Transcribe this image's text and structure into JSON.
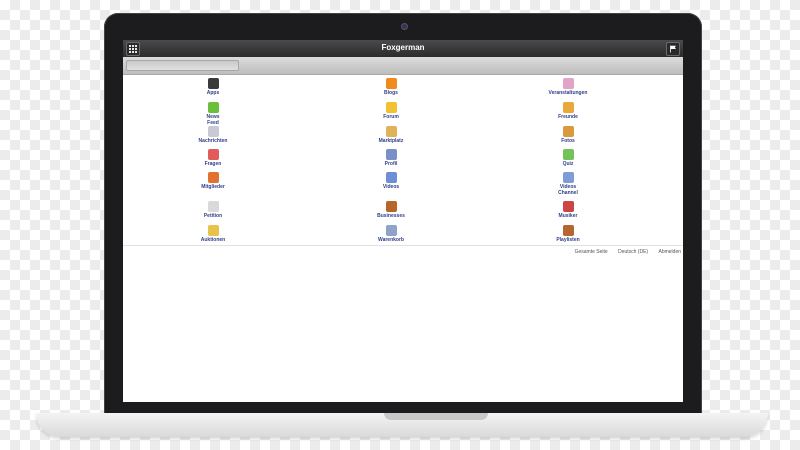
{
  "app": {
    "title": "Foxgerman"
  },
  "search": {
    "value": "",
    "placeholder": ""
  },
  "icons": {
    "menu": "grid-menu-icon",
    "flag": "flag-icon"
  },
  "colors": {
    "link": "#2f3e8a",
    "titlebar": "#2b2b2b"
  },
  "apps": [
    {
      "label": "Apps",
      "icon": "apps-icon",
      "color": "#3a3a3a"
    },
    {
      "label": "Blogs",
      "icon": "blogs-icon",
      "color": "#f08a1c"
    },
    {
      "label": "Veranstaltungen",
      "icon": "calendar-icon",
      "color": "#e3a3c8"
    },
    {
      "label": "News\nFeed",
      "icon": "news-feed-icon",
      "color": "#6cbf3a"
    },
    {
      "label": "Forum",
      "icon": "forum-icon",
      "color": "#f1c232"
    },
    {
      "label": "Freunde",
      "icon": "friends-icon",
      "color": "#e8a93a"
    },
    {
      "label": "Nachrichten",
      "icon": "messages-icon",
      "color": "#c9c9d6"
    },
    {
      "label": "Marktplatz",
      "icon": "marketplace-icon",
      "color": "#e0b456"
    },
    {
      "label": "Fotos",
      "icon": "photos-icon",
      "color": "#d99a3e"
    },
    {
      "label": "Fragen",
      "icon": "questions-icon",
      "color": "#e25b5b"
    },
    {
      "label": "Profil",
      "icon": "profile-icon",
      "color": "#7a8fc4"
    },
    {
      "label": "Quiz",
      "icon": "quiz-icon",
      "color": "#73c25a"
    },
    {
      "label": "Mitglieder",
      "icon": "members-icon",
      "color": "#e0712e"
    },
    {
      "label": "Videos",
      "icon": "videos-icon",
      "color": "#6f8ed6"
    },
    {
      "label": "Videos\nChannel",
      "icon": "video-channel-icon",
      "color": "#7f9bd8"
    },
    {
      "label": "Petition",
      "icon": "petition-icon",
      "color": "#d9d9d9"
    },
    {
      "label": "Businesses",
      "icon": "businesses-icon",
      "color": "#b8652a"
    },
    {
      "label": "Musiker",
      "icon": "musician-icon",
      "color": "#cc4444"
    },
    {
      "label": "Auktionen",
      "icon": "auctions-icon",
      "color": "#e8c24a"
    },
    {
      "label": "Warenkorb",
      "icon": "cart-icon",
      "color": "#8fa3c8"
    },
    {
      "label": "Playlisten",
      "icon": "playlist-icon",
      "color": "#b5652e"
    }
  ],
  "footer": {
    "full_site": "Gesamte Seite",
    "language": "Deutsch (DE)",
    "logout": "Abmelden"
  }
}
